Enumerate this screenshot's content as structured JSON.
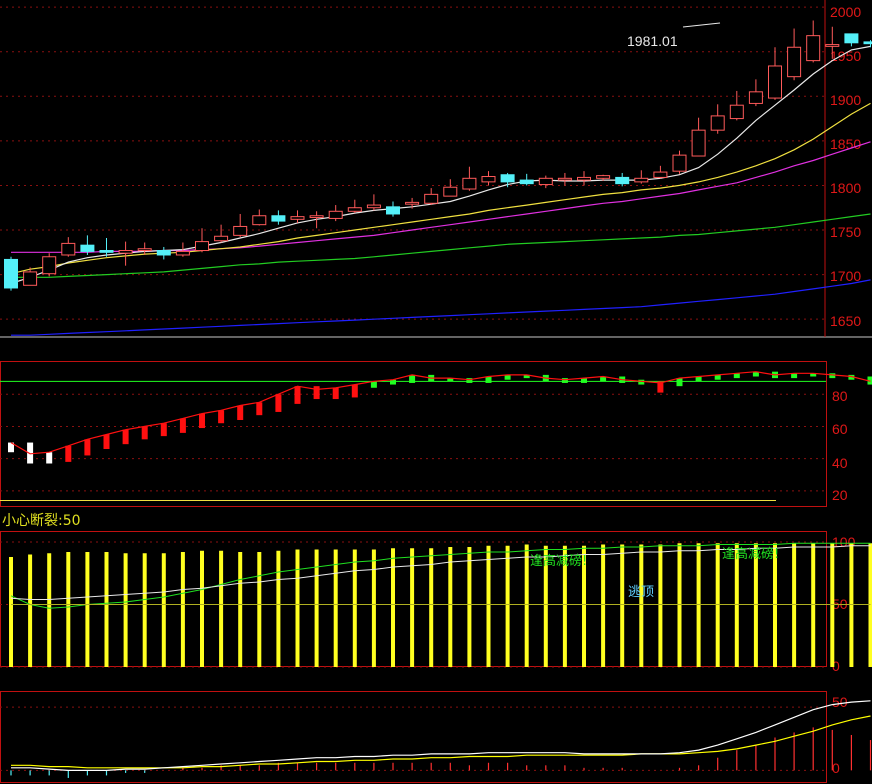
{
  "colors": {
    "background": "#000000",
    "frame": "#c01010",
    "axis_text": "#e01818",
    "up_candle": "#ff5a5a",
    "down_candle": "#54f0f8",
    "ma5": "#e8e8e8",
    "ma10": "#f0e040",
    "ma20": "#e030e0",
    "ma60": "#22cc22",
    "ma120": "#2020ff",
    "osc_rise": "#ff1010",
    "osc_high": "#20ff20",
    "osc_low": "#ffffff",
    "strength_bar": "#ffff20",
    "macd_dif": "#ffffff",
    "macd_dea": "#ffff00",
    "macd_bar": "#ff3030",
    "note_green": "#20e020",
    "note_cyan": "#60d0ff",
    "panel3_title": "#e0e020"
  },
  "price_panel": {
    "high_label": "1981.01",
    "y_ticks": [
      "2000",
      "1950",
      "1900",
      "1850",
      "1800",
      "1750",
      "1700",
      "1650"
    ],
    "y_tick_values": [
      2000,
      1950,
      1900,
      1850,
      1800,
      1750,
      1700,
      1650
    ]
  },
  "osc_panel": {
    "y_ticks": [
      "80",
      "60",
      "40",
      "20"
    ],
    "y_tick_values": [
      80,
      60,
      40,
      20
    ]
  },
  "strength_panel": {
    "title": "小心断裂:50",
    "y_ticks": [
      "100",
      "50",
      "0"
    ],
    "y_tick_values": [
      100,
      50,
      0
    ],
    "notes": {
      "peak_warning_1": "逢高减磅!",
      "peak_warning_2": "逢高减磅!",
      "escape_top": "逃顶"
    }
  },
  "macd_panel": {
    "y_ticks": [
      "50",
      "0"
    ],
    "y_tick_values": [
      50,
      0
    ]
  },
  "chart_data": {
    "type": "candlestick",
    "open": [
      1717,
      1688,
      1701,
      1722,
      1733,
      1727,
      1724,
      1727,
      1727,
      1722,
      1727,
      1738,
      1744,
      1756,
      1766,
      1762,
      1764,
      1763,
      1771,
      1775,
      1776,
      1779,
      1780,
      1788,
      1796,
      1804,
      1812,
      1806,
      1801,
      1806,
      1806,
      1808,
      1809,
      1804,
      1809,
      1816,
      1833,
      1862,
      1875,
      1892,
      1898,
      1922,
      1940,
      1956,
      1970,
      1961
    ],
    "close": [
      1685,
      1703,
      1720,
      1735,
      1726,
      1725,
      1727,
      1729,
      1722,
      1726,
      1737,
      1743,
      1754,
      1766,
      1760,
      1765,
      1766,
      1771,
      1775,
      1778,
      1768,
      1781,
      1790,
      1798,
      1808,
      1810,
      1804,
      1802,
      1808,
      1808,
      1809,
      1811,
      1802,
      1808,
      1815,
      1834,
      1862,
      1878,
      1890,
      1905,
      1934,
      1955,
      1968,
      1958,
      1960,
      1959
    ],
    "high": [
      1720,
      1708,
      1724,
      1742,
      1744,
      1741,
      1737,
      1736,
      1731,
      1736,
      1752,
      1756,
      1768,
      1773,
      1772,
      1772,
      1771,
      1778,
      1784,
      1790,
      1782,
      1786,
      1797,
      1807,
      1821,
      1816,
      1814,
      1813,
      1811,
      1814,
      1816,
      1812,
      1814,
      1817,
      1822,
      1839,
      1876,
      1891,
      1906,
      1919,
      1955,
      1976,
      1985,
      1978,
      1966,
      1963
    ],
    "low": [
      1682,
      1688,
      1698,
      1720,
      1722,
      1720,
      1710,
      1722,
      1717,
      1720,
      1725,
      1736,
      1742,
      1755,
      1756,
      1758,
      1752,
      1760,
      1769,
      1772,
      1765,
      1774,
      1778,
      1788,
      1794,
      1800,
      1798,
      1800,
      1797,
      1800,
      1800,
      1805,
      1799,
      1802,
      1808,
      1813,
      1833,
      1858,
      1873,
      1889,
      1896,
      1918,
      1938,
      1942,
      1956,
      1955
    ],
    "ma5": [
      1690,
      1697,
      1705,
      1714,
      1719,
      1722,
      1724,
      1726,
      1727,
      1728,
      1732,
      1736,
      1741,
      1746,
      1752,
      1758,
      1762,
      1765,
      1769,
      1772,
      1774,
      1776,
      1779,
      1782,
      1788,
      1795,
      1801,
      1805,
      1806,
      1805,
      1805,
      1806,
      1806,
      1806,
      1808,
      1812,
      1820,
      1835,
      1853,
      1873,
      1890,
      1907,
      1925,
      1940,
      1952,
      1956
    ],
    "ma10": [
      1701,
      1706,
      1709,
      1713,
      1716,
      1719,
      1721,
      1723,
      1724,
      1725,
      1727,
      1729,
      1731,
      1734,
      1737,
      1741,
      1744,
      1747,
      1750,
      1753,
      1756,
      1759,
      1762,
      1765,
      1768,
      1772,
      1775,
      1778,
      1781,
      1784,
      1787,
      1790,
      1792,
      1795,
      1797,
      1800,
      1804,
      1809,
      1815,
      1822,
      1830,
      1840,
      1852,
      1866,
      1880,
      1892
    ],
    "ma20": [
      1725,
      1725,
      1725,
      1725,
      1725,
      1726,
      1726,
      1726,
      1727,
      1727,
      1728,
      1729,
      1730,
      1732,
      1734,
      1736,
      1738,
      1740,
      1742,
      1744,
      1747,
      1750,
      1753,
      1756,
      1759,
      1762,
      1765,
      1768,
      1771,
      1774,
      1777,
      1780,
      1782,
      1785,
      1788,
      1791,
      1795,
      1799,
      1803,
      1809,
      1815,
      1822,
      1828,
      1835,
      1842,
      1849
    ],
    "ma60": [
      1697,
      1697,
      1697,
      1698,
      1699,
      1700,
      1701,
      1702,
      1703,
      1705,
      1707,
      1709,
      1711,
      1712,
      1714,
      1715,
      1716,
      1717,
      1718,
      1720,
      1722,
      1724,
      1726,
      1728,
      1730,
      1732,
      1734,
      1735,
      1736,
      1737,
      1738,
      1739,
      1740,
      1741,
      1742,
      1744,
      1745,
      1747,
      1749,
      1751,
      1753,
      1756,
      1759,
      1762,
      1765,
      1768
    ],
    "ma120": [
      1632,
      1632,
      1633,
      1634,
      1635,
      1636,
      1637,
      1638,
      1639,
      1640,
      1641,
      1642,
      1643,
      1644,
      1645,
      1646,
      1647,
      1648,
      1649,
      1650,
      1651,
      1652,
      1653,
      1654,
      1655,
      1656,
      1657,
      1658,
      1659,
      1660,
      1661,
      1662,
      1663,
      1664,
      1666,
      1668,
      1670,
      1672,
      1674,
      1676,
      1678,
      1681,
      1684,
      1687,
      1690,
      1694
    ],
    "oscillator": [
      50,
      43,
      44,
      48,
      52,
      55,
      58,
      60,
      62,
      65,
      68,
      70,
      73,
      75,
      80,
      85,
      83,
      84,
      86,
      88,
      89,
      92,
      90,
      90,
      89,
      91,
      92,
      92,
      90,
      89,
      90,
      91,
      89,
      88,
      87,
      90,
      91,
      92,
      93,
      94,
      92,
      93,
      93,
      92,
      91,
      88
    ],
    "strength": [
      88,
      90,
      91,
      92,
      92,
      92,
      91,
      91,
      91,
      92,
      93,
      93,
      92,
      92,
      93,
      94,
      94,
      94,
      94,
      94,
      95,
      95,
      95,
      96,
      96,
      97,
      97,
      98,
      97,
      97,
      97,
      98,
      98,
      98,
      98,
      99,
      99,
      99,
      99,
      99,
      99,
      99,
      99,
      99,
      99,
      99
    ],
    "strength_line_a": [
      57,
      50,
      47,
      48,
      50,
      51,
      52,
      54,
      56,
      59,
      62,
      66,
      70,
      73,
      76,
      78,
      80,
      82,
      84,
      85,
      87,
      88,
      89,
      90,
      91,
      92,
      92,
      93,
      94,
      94,
      95,
      95,
      96,
      96,
      97,
      97,
      97,
      98,
      98,
      98,
      98,
      99,
      99,
      99,
      99,
      99
    ],
    "strength_line_b": [
      55,
      54,
      54,
      55,
      56,
      57,
      58,
      59,
      60,
      62,
      63,
      65,
      67,
      68,
      70,
      71,
      73,
      75,
      77,
      78,
      80,
      81,
      82,
      84,
      85,
      86,
      87,
      88,
      88,
      89,
      90,
      90,
      91,
      92,
      92,
      93,
      93,
      94,
      94,
      95,
      95,
      96,
      96,
      96,
      97,
      97
    ],
    "strength_flag": [
      50,
      50,
      50,
      50,
      50,
      50,
      50,
      50,
      50,
      50,
      50,
      50,
      50,
      50,
      50,
      50,
      50,
      50,
      50,
      50,
      50,
      50,
      50,
      50,
      50,
      50,
      50,
      50,
      50,
      50,
      50,
      50,
      50,
      50,
      50,
      50,
      50,
      50,
      50,
      50,
      50,
      50,
      50,
      50,
      50,
      50
    ],
    "macd_dif": [
      2,
      2,
      1,
      0,
      0,
      0,
      1,
      1,
      2,
      3,
      4,
      5,
      6,
      7,
      8,
      9,
      10,
      10,
      11,
      11,
      12,
      12,
      13,
      13,
      13,
      14,
      14,
      14,
      14,
      14,
      13,
      13,
      13,
      13,
      13,
      14,
      16,
      20,
      25,
      30,
      36,
      42,
      48,
      52,
      54,
      55
    ],
    "macd_dea": [
      4,
      4,
      3,
      3,
      2,
      2,
      2,
      2,
      2,
      2,
      3,
      3,
      4,
      5,
      5,
      6,
      7,
      7,
      8,
      8,
      9,
      9,
      10,
      10,
      11,
      11,
      11,
      12,
      12,
      12,
      12,
      12,
      12,
      13,
      13,
      13,
      14,
      15,
      17,
      20,
      23,
      27,
      31,
      36,
      40,
      43
    ],
    "macd_hist": [
      -4,
      -4,
      -4,
      -6,
      -4,
      -4,
      -2,
      -2,
      0,
      2,
      2,
      4,
      4,
      4,
      6,
      6,
      6,
      6,
      6,
      6,
      6,
      6,
      6,
      6,
      4,
      6,
      6,
      4,
      4,
      4,
      2,
      2,
      2,
      0,
      0,
      2,
      4,
      10,
      16,
      20,
      26,
      30,
      34,
      32,
      28,
      24
    ],
    "y_range_price": [
      1630,
      2008
    ],
    "y_range_osc": [
      10,
      100
    ],
    "y_range_strength": [
      0,
      108
    ],
    "y_range_macd": [
      -10,
      62
    ],
    "grid": true
  }
}
